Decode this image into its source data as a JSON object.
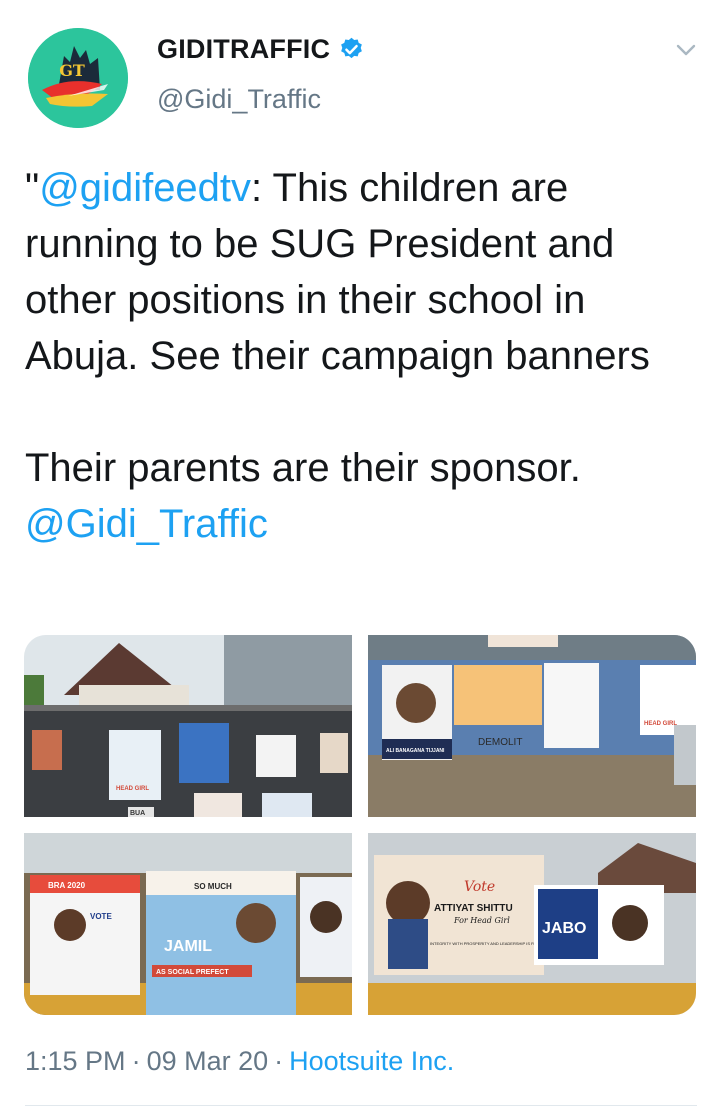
{
  "author": {
    "display_name": "GIDITRAFFIC",
    "handle": "@Gidi_Traffic",
    "avatar_initials": "GT",
    "verified": true
  },
  "tweet": {
    "quote_open": "\"",
    "mention_1": "@gidifeedtv",
    "text_1": ": This children are running to be SUG President and other positions in their school in Abuja. See their campaign banners\n\nTheir parents are their sponsor. ",
    "mention_2": "@Gidi_Traffic"
  },
  "media": {
    "photos": [
      {
        "banner_1": "HEAD GIRL",
        "banner_2": "BUA"
      },
      {
        "banner_1": "ALI BANAGANA TIJJANI",
        "banner_2": "HEAD GIRL",
        "banner_3": "DEMOLIT"
      },
      {
        "banner_1": "BRA 2020",
        "banner_2": "VOTE",
        "banner_3": "JAMIL",
        "banner_4": "AS SOCIAL PREFECT",
        "banner_5": "SO MUCH"
      },
      {
        "banner_1": "Vote",
        "banner_2": "ATTIYAT SHITTU",
        "banner_3": "For Head Girl",
        "banner_4": "INTEGRITY WITH PROSPERITY AND LEADERSHIP IS PARAMOUNT",
        "banner_5": "JABO"
      }
    ]
  },
  "footer": {
    "time": "1:15 PM",
    "separator": "·",
    "date": "09 Mar 20",
    "source": "Hootsuite Inc."
  },
  "colors": {
    "link": "#1da1f2",
    "muted": "#657786",
    "text": "#14171a"
  },
  "icons": {
    "verified": "verified-badge-icon",
    "caret": "chevron-down-icon"
  }
}
